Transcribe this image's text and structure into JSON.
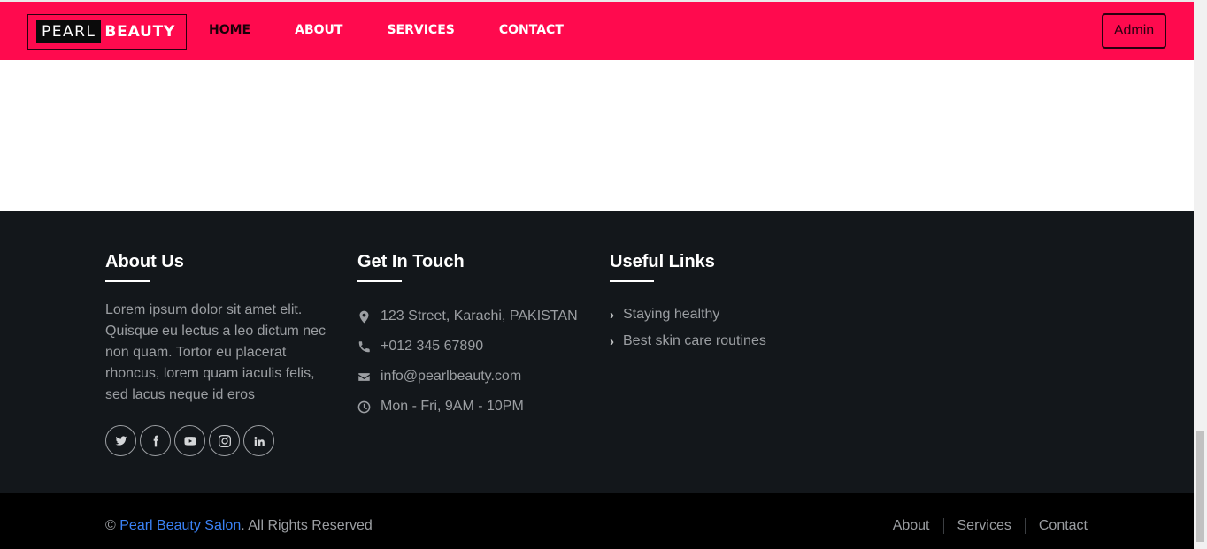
{
  "header": {
    "logo_part1": "PEARL",
    "logo_part2": "BEAUTY",
    "nav": [
      "HOME",
      "ABOUT",
      "SERVICES",
      "CONTACT"
    ],
    "admin_label": "Admin"
  },
  "footer": {
    "about": {
      "title": "About Us",
      "text": "Lorem ipsum dolor sit amet elit. Quisque eu lectus a leo dictum nec non quam. Tortor eu placerat rhoncus, lorem quam iaculis felis, sed lacus neque id eros",
      "socials": [
        "twitter-icon",
        "facebook-icon",
        "youtube-icon",
        "instagram-icon",
        "linkedin-icon"
      ]
    },
    "contact": {
      "title": "Get In Touch",
      "address": "123 Street, Karachi, PAKISTAN",
      "phone": "+012 345 67890",
      "email": "info@pearlbeauty.com",
      "hours": "Mon - Fri, 9AM - 10PM"
    },
    "links": {
      "title": "Useful Links",
      "items": [
        "Staying healthy",
        "Best skin care routines"
      ]
    }
  },
  "bottom": {
    "copyright_symbol": "©",
    "brand": "Pearl Beauty Salon",
    "rights": ". All Rights Reserved",
    "links": [
      "About",
      "Services",
      "Contact"
    ]
  },
  "colors": {
    "brand_pink": "#ff0a4e",
    "footer_bg": "#13171b",
    "bottom_bg": "#000000",
    "link_blue": "#3b82f6"
  }
}
